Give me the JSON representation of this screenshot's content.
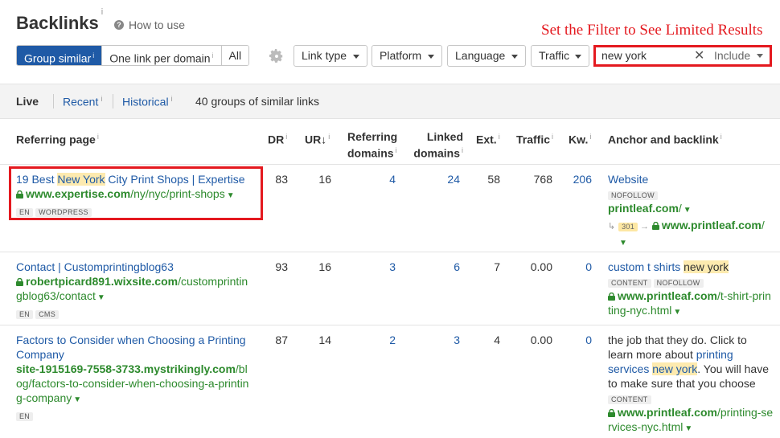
{
  "header": {
    "title": "Backlinks",
    "title_info": "i",
    "how_to_use": "How to use",
    "annotation": "Set the Filter to See Limited Results"
  },
  "toolbar": {
    "group_similar": "Group similar",
    "one_link_per_domain": "One link per domain",
    "all": "All",
    "link_type": "Link type",
    "platform": "Platform",
    "language": "Language",
    "traffic": "Traffic",
    "search_value": "new york",
    "include": "Include"
  },
  "subbar": {
    "live": "Live",
    "recent": "Recent",
    "historical": "Historical",
    "count_text": "40 groups of similar links"
  },
  "columns": {
    "referring_page": "Referring page",
    "dr": "DR",
    "ur": "UR",
    "ref_domains_1": "Referring",
    "ref_domains_2": "domains",
    "linked_domains_1": "Linked",
    "linked_domains_2": "domains",
    "ext": "Ext.",
    "traffic": "Traffic",
    "kw": "Kw.",
    "anchor": "Anchor and backlink"
  },
  "rows": [
    {
      "title_pre": "19 Best ",
      "title_hl": "New York",
      "title_post": " City Print Shops | Expertise",
      "domain": "www.expertise.com",
      "path": "/ny/nyc/print-shops",
      "tags": [
        "EN",
        "WORDPRESS"
      ],
      "dr": "83",
      "ur": "16",
      "ref_domains": "4",
      "linked_domains": "24",
      "ext": "58",
      "traffic": "768",
      "kw": "206",
      "anchor": "Website",
      "anchor_tags": [
        "NOFOLLOW"
      ],
      "target_domain": "printleaf.com",
      "target_path": "/",
      "redirect_code": "301",
      "redirect_domain": "www.printleaf.com",
      "redirect_path": "/"
    },
    {
      "title": "Contact | Customprintingblog63",
      "domain": "robertpicard891.wixsite.com",
      "path_1": "/customprintin",
      "path_2": "gblog63/contact",
      "tags": [
        "EN",
        "CMS"
      ],
      "dr": "93",
      "ur": "16",
      "ref_domains": "3",
      "linked_domains": "6",
      "ext": "7",
      "traffic": "0.00",
      "kw": "0",
      "anchor_pre": "custom t shirts ",
      "anchor_hl": "new york",
      "anchor_tags": [
        "CONTENT",
        "NOFOLLOW"
      ],
      "target_domain": "www.printleaf.com",
      "target_path_1": "/t-shirt-prin",
      "target_path_2": "ting-nyc.html"
    },
    {
      "title_1": "Factors to Consider when Choosing a Printing",
      "title_2": "Company",
      "domain": "site-1915169-7558-3733.mystrikingly.com",
      "path_1": "/bl",
      "path_2": "og/factors-to-consider-when-choosing-a-printin",
      "path_3": "g-company",
      "tags": [
        "EN"
      ],
      "dr": "87",
      "ur": "14",
      "ref_domains": "2",
      "linked_domains": "3",
      "ext": "4",
      "traffic": "0.00",
      "kw": "0",
      "anchor_l1": "the job that they do. Click to",
      "anchor_l2_pre": "learn more about ",
      "anchor_l2_link": "printing",
      "anchor_l3_link": "services ",
      "anchor_l3_hl": "new york",
      "anchor_l3_post": ". You will have",
      "anchor_l4": "to make sure that you choose",
      "anchor_tags": [
        "CONTENT"
      ],
      "target_domain": "www.printleaf.com",
      "target_path_1": "/printing-se",
      "target_path_2": "rvices-nyc.html"
    }
  ]
}
